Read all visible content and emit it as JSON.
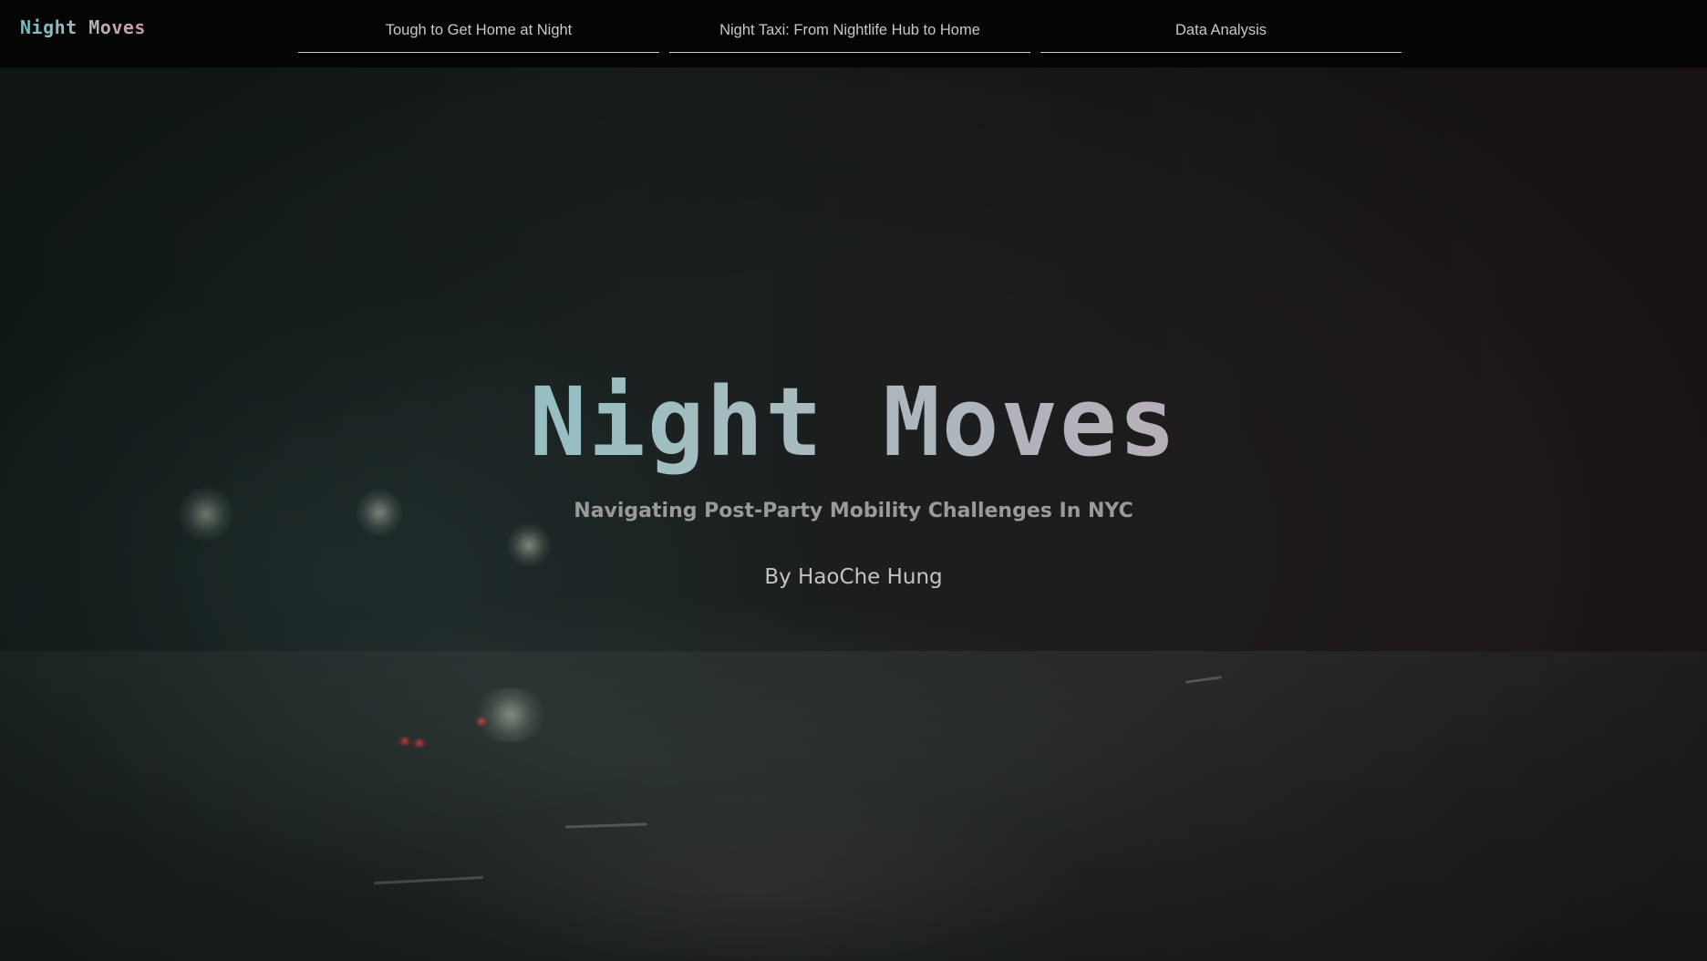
{
  "header": {
    "brand": "Night Moves",
    "nav": [
      {
        "label": "Tough to Get Home at Night"
      },
      {
        "label": "Night Taxi: From Nightlife Hub to Home"
      },
      {
        "label": "Data Analysis"
      }
    ]
  },
  "hero": {
    "title": "Night Moves",
    "subtitle": "Navigating Post-Party Mobility Challenges In NYC",
    "author": "By HaoChe Hung"
  },
  "colors": {
    "gradient_start": "#6fc6c6",
    "gradient_end": "#d98f98",
    "topbar_bg": "#040404",
    "nav_text": "#c9c9c9"
  }
}
